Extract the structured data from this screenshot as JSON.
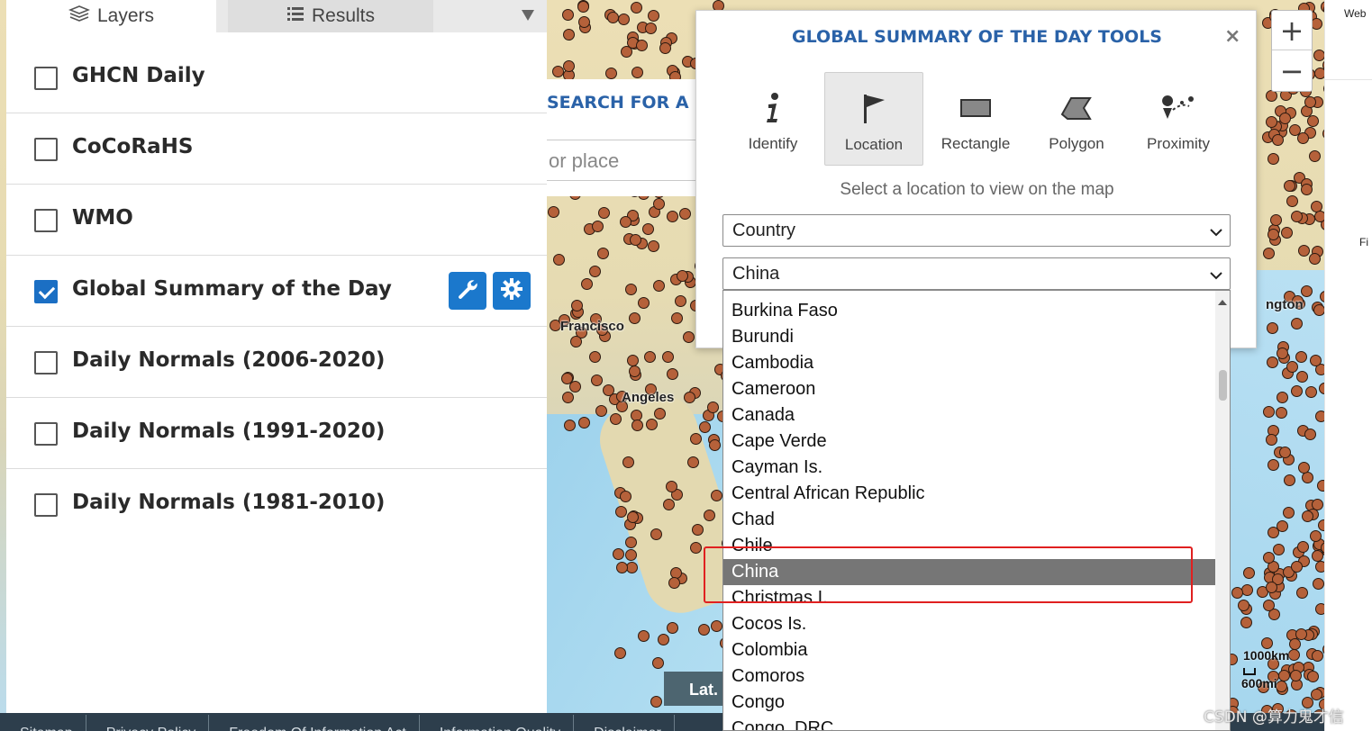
{
  "panel": {
    "tabs": [
      {
        "label": "Layers",
        "icon": "layers-icon",
        "active": true
      },
      {
        "label": "Results",
        "icon": "list-icon",
        "active": false
      }
    ],
    "layers": [
      {
        "name": "GHCN Daily",
        "checked": false
      },
      {
        "name": "CoCoRaHS",
        "checked": false
      },
      {
        "name": "WMO",
        "checked": false
      },
      {
        "name": "Global Summary of the Day",
        "checked": true,
        "tools": [
          "wrench-icon",
          "gear-icon"
        ]
      },
      {
        "name": "Daily Normals (2006-2020)",
        "checked": false
      },
      {
        "name": "Daily Normals (1991-2020)",
        "checked": false
      },
      {
        "name": "Daily Normals (1981-2010)",
        "checked": false
      }
    ]
  },
  "search": {
    "title": "SEARCH FOR A L",
    "placeholder": "or place"
  },
  "dialog": {
    "title": "GLOBAL SUMMARY OF THE DAY TOOLS",
    "close": "×",
    "tools": [
      {
        "label": "Identify",
        "icon": "info-icon",
        "active": false
      },
      {
        "label": "Location",
        "icon": "flag-icon",
        "active": true
      },
      {
        "label": "Rectangle",
        "icon": "rectangle-icon",
        "active": false
      },
      {
        "label": "Polygon",
        "icon": "polygon-icon",
        "active": false
      },
      {
        "label": "Proximity",
        "icon": "proximity-icon",
        "active": false
      }
    ],
    "hint": "Select a location to view on the map",
    "location_type": "Country",
    "location_value": "China"
  },
  "dropdown": {
    "options": [
      "Burkina Faso",
      "Burundi",
      "Cambodia",
      "Cameroon",
      "Canada",
      "Cape Verde",
      "Cayman Is.",
      "Central African Republic",
      "Chad",
      "Chile",
      "China",
      "Christmas I.",
      "Cocos Is.",
      "Colombia",
      "Comoros",
      "Congo",
      "Congo, DRC"
    ],
    "selected": "China"
  },
  "map": {
    "labels": [
      "Francisco",
      "Angeles",
      "ngton"
    ],
    "scale_km": "1000km",
    "scale_mi": "600mi",
    "lat_label": "Lat.",
    "zoom_in": "+",
    "zoom_out": "−"
  },
  "footer": {
    "links": [
      "Sitemap",
      "Privacy Policy",
      "Freedom Of Information Act",
      "Information Quality",
      "Disclaimer"
    ]
  },
  "side": {
    "web_label": "Web",
    "fi_label": "Fi"
  },
  "watermark": "CSDN @算力鬼才信",
  "colors": {
    "accent": "#1b78cc",
    "title_blue": "#2a62a8",
    "station_fill": "#b5613a",
    "highlight_red": "#e02020",
    "footer_bg": "#2d3e4c"
  }
}
